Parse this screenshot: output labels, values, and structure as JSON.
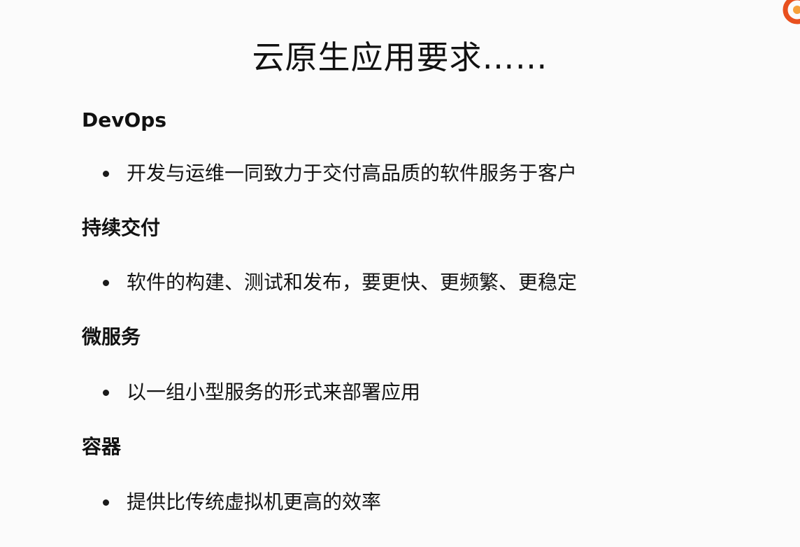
{
  "slide": {
    "title": "云原生应用要求……",
    "sections": [
      {
        "heading": "DevOps",
        "bullet": "开发与运维一同致力于交付高品质的软件服务于客户"
      },
      {
        "heading": "持续交付",
        "bullet": "软件的构建、测试和发布，要更快、更频繁、更稳定"
      },
      {
        "heading": "微服务",
        "bullet": "以一组小型服务的形式来部署应用"
      },
      {
        "heading": "容器",
        "bullet": "提供比传统虚拟机更高的效率"
      }
    ]
  },
  "logo": {
    "icon": "brand-logo-icon",
    "color": "#e8501e"
  }
}
